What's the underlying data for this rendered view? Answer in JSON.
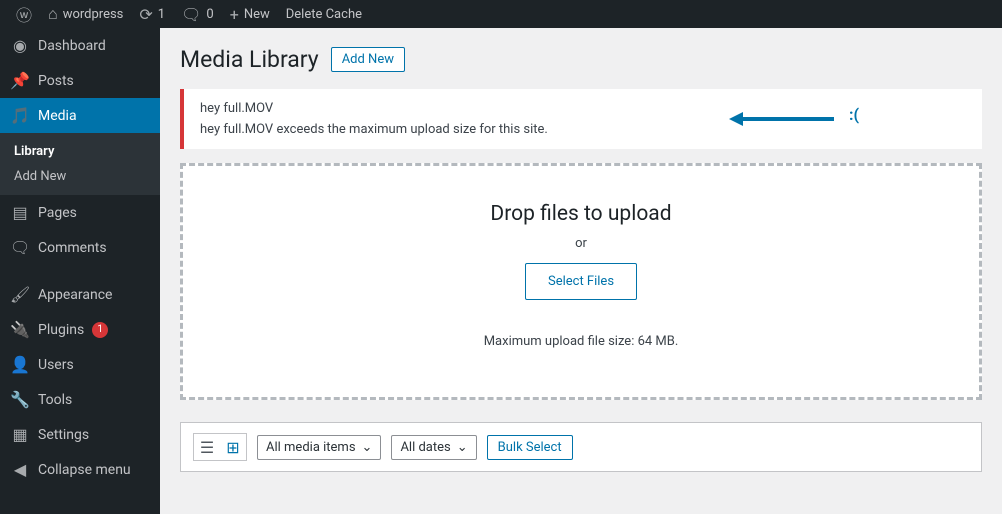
{
  "adminbar": {
    "site_name": "wordpress",
    "updates_count": "1",
    "comments_count": "0",
    "new_label": "New",
    "cache_label": "Delete Cache"
  },
  "sidebar": {
    "dashboard": "Dashboard",
    "posts": "Posts",
    "media": "Media",
    "media_sub_library": "Library",
    "media_sub_addnew": "Add New",
    "pages": "Pages",
    "comments": "Comments",
    "appearance": "Appearance",
    "plugins": "Plugins",
    "plugins_badge": "1",
    "users": "Users",
    "tools": "Tools",
    "settings": "Settings",
    "collapse": "Collapse menu"
  },
  "page": {
    "title": "Media Library",
    "add_new": "Add New"
  },
  "error": {
    "filename": "hey full.MOV",
    "message": "hey full.MOV exceeds the maximum upload size for this site.",
    "sad_face": ":("
  },
  "uploader": {
    "drop_text": "Drop files to upload",
    "or": "or",
    "select_btn": "Select Files",
    "max_size": "Maximum upload file size: 64 MB."
  },
  "filters": {
    "media_items": "All media items",
    "dates": "All dates",
    "bulk_select": "Bulk Select"
  }
}
